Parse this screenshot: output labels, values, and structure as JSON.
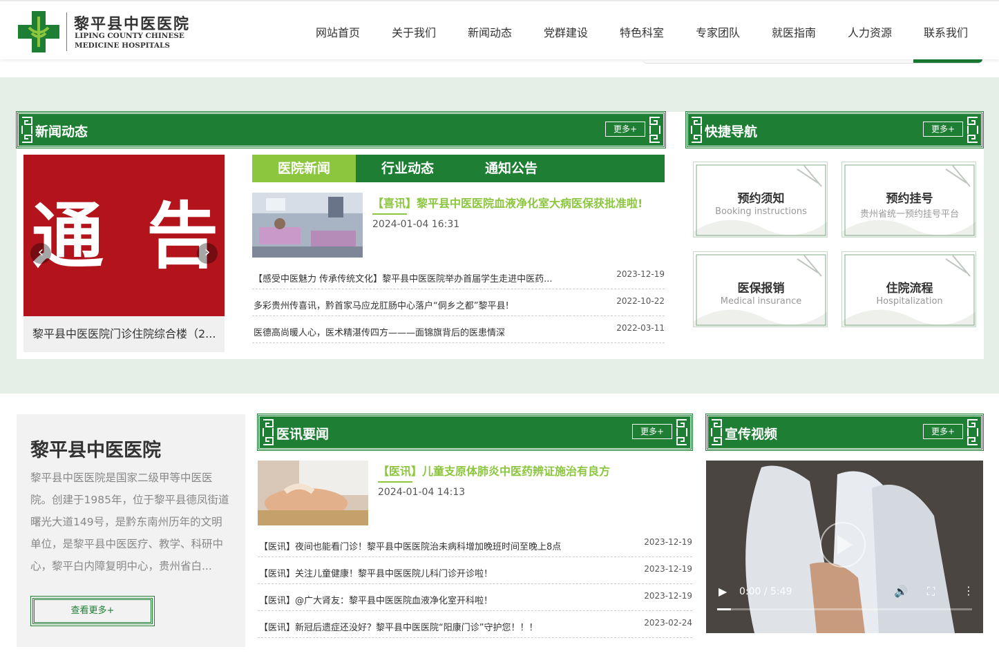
{
  "header": {
    "logo_cn": "黎平县中医医院",
    "logo_en_line1": "LIPING COUNTY CHINESE",
    "logo_en_line2": "MEDICINE HOSPITALS",
    "nav": [
      "网站首页",
      "关于我们",
      "新闻动态",
      "党群建设",
      "特色科室",
      "专家团队",
      "就医指南",
      "人力资源",
      "联系我们"
    ]
  },
  "news": {
    "title": "新闻动态",
    "more": "更多+",
    "banner_chars": [
      "通",
      "告"
    ],
    "banner_caption": "黎平县中医医院门诊住院综合楼（2...",
    "tabs": [
      "医院新闻",
      "行业动态",
      "通知公告"
    ],
    "featured": {
      "title": "【喜讯】黎平县中医医院血液净化室大病医保获批准啦!",
      "date": "2024-01-04 16:31"
    },
    "items": [
      {
        "text": "【感受中医魅力 传承传统文化】黎平县中医医院举办首届学生走进中医药...",
        "date": "2023-12-19"
      },
      {
        "text": "多彩贵州传喜讯，黔首家马应龙肛肠中心落户“侗乡之都”黎平县!",
        "date": "2022-10-22"
      },
      {
        "text": "医德高尚暖人心，医术精湛传四方———面锦旗背后的医患情深",
        "date": "2022-03-11"
      }
    ]
  },
  "quicknav": {
    "title": "快捷导航",
    "more": "更多+",
    "cards": [
      {
        "title": "预约须知",
        "sub": "Booking instructions"
      },
      {
        "title": "预约挂号",
        "sub": "贵州省统一预约挂号平台"
      },
      {
        "title": "医保报销",
        "sub": "Medical insurance"
      },
      {
        "title": "住院流程",
        "sub": "Hospitalization"
      }
    ]
  },
  "about": {
    "title": "黎平县中医医院",
    "text": "黎平县中医医院是国家二级甲等中医医院。创建于1985年，位于黎平县德凤街道曙光大道149号，是黔东南州历年的文明单位，是黎平县中医医疗、教学、科研中心，黎平白内障复明中心，贵州省白...",
    "more": "查看更多+"
  },
  "medical": {
    "title": "医讯要闻",
    "more": "更多+",
    "featured": {
      "title": "【医讯】儿童支原体肺炎中医药辨证施治有良方",
      "date": "2024-01-04 14:13"
    },
    "items": [
      {
        "text": "【医讯】夜间也能看门诊！黎平县中医医院治未病科增加晚班时间至晚上8点",
        "date": "2023-12-19"
      },
      {
        "text": "【医讯】关注儿童健康！黎平县中医医院儿科门诊开诊啦！",
        "date": "2023-12-19"
      },
      {
        "text": "【医讯】@广大肾友：黎平县中医医院血液净化室开科啦！",
        "date": "2023-12-19"
      },
      {
        "text": "【医讯】新冠后遗症还没好？黎平县中医医院“阳康门诊”守护您！！！",
        "date": "2023-02-24"
      }
    ]
  },
  "video": {
    "title": "宣传视频",
    "more": "更多+",
    "time": "0:00 / 5:49"
  },
  "colors": {
    "green": "#1e7e34",
    "light_green": "#8cc63f",
    "banner_red": "#b3131b",
    "band": "#e5efe8"
  }
}
